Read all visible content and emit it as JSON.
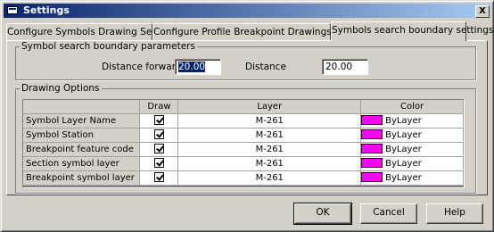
{
  "window": {
    "title": "Settings",
    "close_glyph": "X"
  },
  "tabs": [
    {
      "label": "Configure Symbols Drawing Settings",
      "active": false
    },
    {
      "label": "Configure Profile Breakpoint Drawings Settings",
      "active": false
    },
    {
      "label": "Symbols search boundary settings",
      "active": true
    }
  ],
  "boundary": {
    "legend": "Symbol search boundary parameters",
    "forward_label": "Distance forward",
    "forward_value": "20.00",
    "distance_label": "Distance",
    "distance_value": "20.00"
  },
  "drawing": {
    "legend": "Drawing Options",
    "columns": {
      "name": "",
      "draw": "Draw",
      "layer": "Layer",
      "color": "Color"
    },
    "rows": [
      {
        "name": "Symbol Layer Name",
        "draw": true,
        "layer": "M-261",
        "color": "ByLayer",
        "swatch": "#ff00ff"
      },
      {
        "name": "Symbol Station",
        "draw": true,
        "layer": "M-261",
        "color": "ByLayer",
        "swatch": "#ff00ff"
      },
      {
        "name": "Breakpoint feature code",
        "draw": true,
        "layer": "M-261",
        "color": "ByLayer",
        "swatch": "#ff00ff"
      },
      {
        "name": "Section symbol layer",
        "draw": true,
        "layer": "M-261",
        "color": "ByLayer",
        "swatch": "#ff00ff"
      },
      {
        "name": "Breakpoint symbol layer",
        "draw": true,
        "layer": "M-261",
        "color": "ByLayer",
        "swatch": "#ff00ff"
      }
    ]
  },
  "buttons": {
    "ok": "OK",
    "cancel": "Cancel",
    "help": "Help"
  },
  "colors": {
    "titlebar": "#0a246a",
    "dialog_bg": "#d4d0c8",
    "selection": "#0a246a",
    "bylayer_swatch": "#ff00ff"
  }
}
